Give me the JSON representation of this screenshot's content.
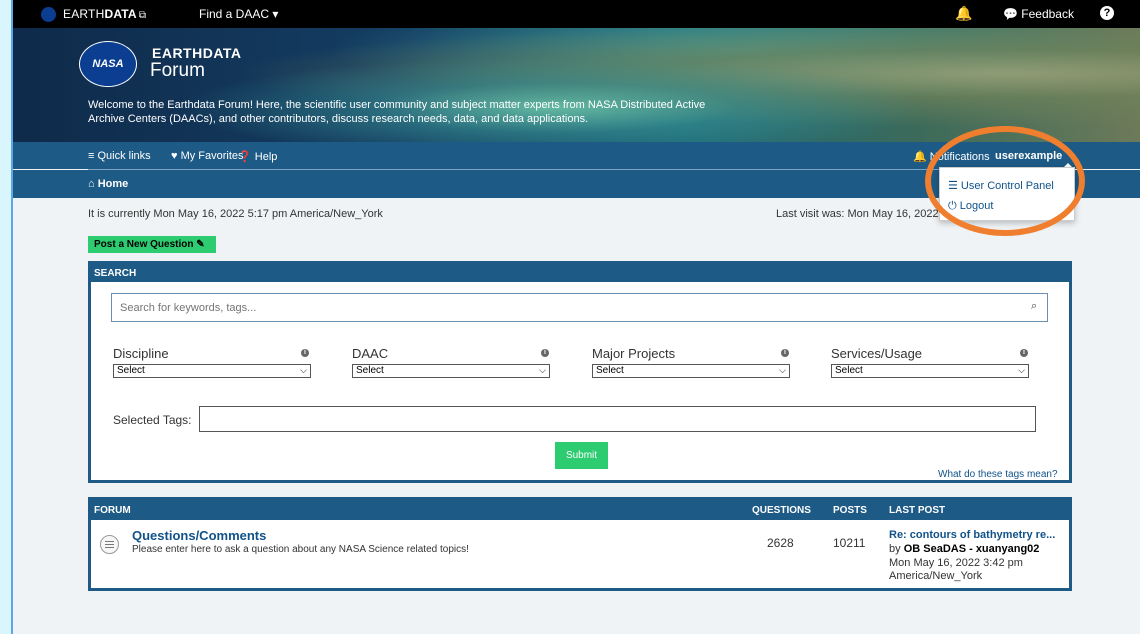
{
  "topbar": {
    "brand_light": "EARTH",
    "brand_bold": "DATA",
    "brand_ext": "⧉",
    "find_daac": "Find a DAAC ▾",
    "bell": "🔔",
    "feedback": "💬 Feedback",
    "help": "?"
  },
  "banner": {
    "logo_text": "NASA",
    "title": "EARTHDATA",
    "subtitle": "Forum",
    "welcome": "Welcome to the Earthdata Forum! Here, the scientific user community and subject matter experts from NASA Distributed Active Archive Centers (DAACs), and other contributors, discuss research needs, data, and data applications."
  },
  "nav": {
    "quick_links": "≡ Quick links",
    "favorites": "♥ My Favorites",
    "help": "❓ Help",
    "notifications": "🔔 Notifications",
    "username": "userexample"
  },
  "breadcrumb": {
    "home": "⌂ Home"
  },
  "user_menu": {
    "ucp": "☰ User Control Panel",
    "logout": "⏻ Logout"
  },
  "info": {
    "current_time": "It is currently Mon May 16, 2022 5:17 pm America/New_York",
    "last_visit": "Last visit was: Mon May 16, 2022"
  },
  "post_button": "Post a New Question ✎",
  "search": {
    "header": "SEARCH",
    "placeholder": "Search for keywords, tags...",
    "icon": "⌕",
    "filters": [
      {
        "label": "Discipline",
        "value": "Select"
      },
      {
        "label": "DAAC",
        "value": "Select"
      },
      {
        "label": "Major Projects",
        "value": "Select"
      },
      {
        "label": "Services/Usage",
        "value": "Select"
      }
    ],
    "info_glyph": "i",
    "select_arrow": "⌵",
    "selected_tags_label": "Selected Tags:",
    "submit": "Submit",
    "tags_help": "What do these tags mean?"
  },
  "forum": {
    "header_forum": "FORUM",
    "header_questions": "QUESTIONS",
    "header_posts": "POSTS",
    "header_last_post": "LAST POST",
    "rows": [
      {
        "title": "Questions/Comments",
        "description": "Please enter here to ask a question about any NASA Science related topics!",
        "questions": "2628",
        "posts": "10211",
        "last_post_title": "Re: contours of bathymetry re...",
        "last_post_by": "by",
        "last_post_author": "OB SeaDAS - xuanyang02",
        "last_post_date": "Mon May 16, 2022 3:42 pm",
        "last_post_tz": "America/New_York"
      }
    ]
  },
  "colors": {
    "nav_blue": "#1d5a86",
    "green": "#2ecc71",
    "link": "#105289",
    "highlight": "#ef7f2e"
  }
}
